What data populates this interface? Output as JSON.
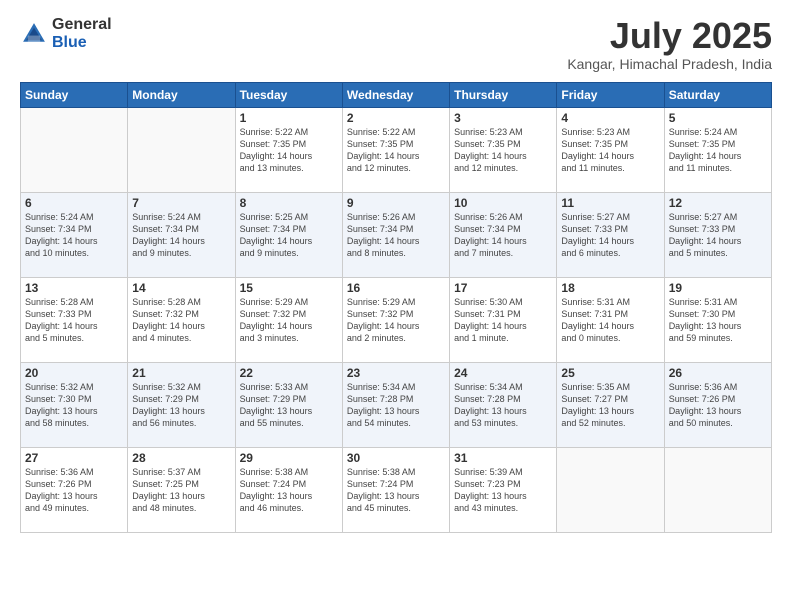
{
  "header": {
    "logo_general": "General",
    "logo_blue": "Blue",
    "month_title": "July 2025",
    "location": "Kangar, Himachal Pradesh, India"
  },
  "days_of_week": [
    "Sunday",
    "Monday",
    "Tuesday",
    "Wednesday",
    "Thursday",
    "Friday",
    "Saturday"
  ],
  "weeks": [
    {
      "alt": false,
      "days": [
        {
          "num": "",
          "detail": ""
        },
        {
          "num": "",
          "detail": ""
        },
        {
          "num": "1",
          "detail": "Sunrise: 5:22 AM\nSunset: 7:35 PM\nDaylight: 14 hours\nand 13 minutes."
        },
        {
          "num": "2",
          "detail": "Sunrise: 5:22 AM\nSunset: 7:35 PM\nDaylight: 14 hours\nand 12 minutes."
        },
        {
          "num": "3",
          "detail": "Sunrise: 5:23 AM\nSunset: 7:35 PM\nDaylight: 14 hours\nand 12 minutes."
        },
        {
          "num": "4",
          "detail": "Sunrise: 5:23 AM\nSunset: 7:35 PM\nDaylight: 14 hours\nand 11 minutes."
        },
        {
          "num": "5",
          "detail": "Sunrise: 5:24 AM\nSunset: 7:35 PM\nDaylight: 14 hours\nand 11 minutes."
        }
      ]
    },
    {
      "alt": true,
      "days": [
        {
          "num": "6",
          "detail": "Sunrise: 5:24 AM\nSunset: 7:34 PM\nDaylight: 14 hours\nand 10 minutes."
        },
        {
          "num": "7",
          "detail": "Sunrise: 5:24 AM\nSunset: 7:34 PM\nDaylight: 14 hours\nand 9 minutes."
        },
        {
          "num": "8",
          "detail": "Sunrise: 5:25 AM\nSunset: 7:34 PM\nDaylight: 14 hours\nand 9 minutes."
        },
        {
          "num": "9",
          "detail": "Sunrise: 5:26 AM\nSunset: 7:34 PM\nDaylight: 14 hours\nand 8 minutes."
        },
        {
          "num": "10",
          "detail": "Sunrise: 5:26 AM\nSunset: 7:34 PM\nDaylight: 14 hours\nand 7 minutes."
        },
        {
          "num": "11",
          "detail": "Sunrise: 5:27 AM\nSunset: 7:33 PM\nDaylight: 14 hours\nand 6 minutes."
        },
        {
          "num": "12",
          "detail": "Sunrise: 5:27 AM\nSunset: 7:33 PM\nDaylight: 14 hours\nand 5 minutes."
        }
      ]
    },
    {
      "alt": false,
      "days": [
        {
          "num": "13",
          "detail": "Sunrise: 5:28 AM\nSunset: 7:33 PM\nDaylight: 14 hours\nand 5 minutes."
        },
        {
          "num": "14",
          "detail": "Sunrise: 5:28 AM\nSunset: 7:32 PM\nDaylight: 14 hours\nand 4 minutes."
        },
        {
          "num": "15",
          "detail": "Sunrise: 5:29 AM\nSunset: 7:32 PM\nDaylight: 14 hours\nand 3 minutes."
        },
        {
          "num": "16",
          "detail": "Sunrise: 5:29 AM\nSunset: 7:32 PM\nDaylight: 14 hours\nand 2 minutes."
        },
        {
          "num": "17",
          "detail": "Sunrise: 5:30 AM\nSunset: 7:31 PM\nDaylight: 14 hours\nand 1 minute."
        },
        {
          "num": "18",
          "detail": "Sunrise: 5:31 AM\nSunset: 7:31 PM\nDaylight: 14 hours\nand 0 minutes."
        },
        {
          "num": "19",
          "detail": "Sunrise: 5:31 AM\nSunset: 7:30 PM\nDaylight: 13 hours\nand 59 minutes."
        }
      ]
    },
    {
      "alt": true,
      "days": [
        {
          "num": "20",
          "detail": "Sunrise: 5:32 AM\nSunset: 7:30 PM\nDaylight: 13 hours\nand 58 minutes."
        },
        {
          "num": "21",
          "detail": "Sunrise: 5:32 AM\nSunset: 7:29 PM\nDaylight: 13 hours\nand 56 minutes."
        },
        {
          "num": "22",
          "detail": "Sunrise: 5:33 AM\nSunset: 7:29 PM\nDaylight: 13 hours\nand 55 minutes."
        },
        {
          "num": "23",
          "detail": "Sunrise: 5:34 AM\nSunset: 7:28 PM\nDaylight: 13 hours\nand 54 minutes."
        },
        {
          "num": "24",
          "detail": "Sunrise: 5:34 AM\nSunset: 7:28 PM\nDaylight: 13 hours\nand 53 minutes."
        },
        {
          "num": "25",
          "detail": "Sunrise: 5:35 AM\nSunset: 7:27 PM\nDaylight: 13 hours\nand 52 minutes."
        },
        {
          "num": "26",
          "detail": "Sunrise: 5:36 AM\nSunset: 7:26 PM\nDaylight: 13 hours\nand 50 minutes."
        }
      ]
    },
    {
      "alt": false,
      "days": [
        {
          "num": "27",
          "detail": "Sunrise: 5:36 AM\nSunset: 7:26 PM\nDaylight: 13 hours\nand 49 minutes."
        },
        {
          "num": "28",
          "detail": "Sunrise: 5:37 AM\nSunset: 7:25 PM\nDaylight: 13 hours\nand 48 minutes."
        },
        {
          "num": "29",
          "detail": "Sunrise: 5:38 AM\nSunset: 7:24 PM\nDaylight: 13 hours\nand 46 minutes."
        },
        {
          "num": "30",
          "detail": "Sunrise: 5:38 AM\nSunset: 7:24 PM\nDaylight: 13 hours\nand 45 minutes."
        },
        {
          "num": "31",
          "detail": "Sunrise: 5:39 AM\nSunset: 7:23 PM\nDaylight: 13 hours\nand 43 minutes."
        },
        {
          "num": "",
          "detail": ""
        },
        {
          "num": "",
          "detail": ""
        }
      ]
    }
  ]
}
